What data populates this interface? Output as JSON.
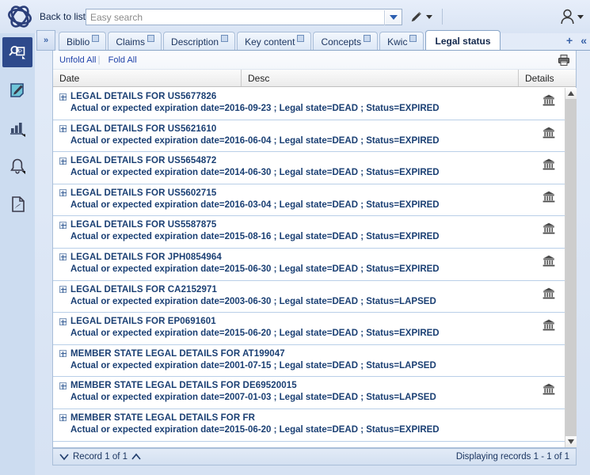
{
  "topbar": {
    "logo_icon": "atom-logo-icon",
    "back_to_list": "Back to list",
    "search_placeholder": "Easy search",
    "search_value": "",
    "dropdown_icon": "chevron-down-icon",
    "pen_icon": "pen-icon",
    "pen_caret_icon": "caret-down-icon",
    "user_icon": "user-icon",
    "user_caret_icon": "caret-down-icon"
  },
  "rail": {
    "items": [
      {
        "icon": "search-patent-icon",
        "active": true
      },
      {
        "icon": "edit-note-icon",
        "active": false
      },
      {
        "icon": "bar-chart-icon",
        "active": false
      },
      {
        "icon": "bell-alert-icon",
        "active": false
      },
      {
        "icon": "pdf-file-icon",
        "active": false
      }
    ]
  },
  "tabbar": {
    "expand_icon": "double-chevron-right-icon",
    "tabs": [
      {
        "label": "Biblio",
        "active": false,
        "popout_icon": "popout-icon"
      },
      {
        "label": "Claims",
        "active": false,
        "popout_icon": "popout-icon"
      },
      {
        "label": "Description",
        "active": false,
        "popout_icon": "popout-icon"
      },
      {
        "label": "Key content",
        "active": false,
        "popout_icon": "popout-icon"
      },
      {
        "label": "Concepts",
        "active": false,
        "popout_icon": "popout-icon"
      },
      {
        "label": "Kwic",
        "active": false,
        "popout_icon": "popout-icon"
      },
      {
        "label": "Legal status",
        "active": true,
        "popout_icon": null
      }
    ],
    "add_label": "+",
    "collapse_label": "«"
  },
  "toolbar": {
    "unfold_all": "Unfold All",
    "fold_all": "Fold All",
    "separator": "|",
    "print_icon": "printer-icon"
  },
  "table": {
    "columns": [
      "Date",
      "Desc",
      "Details"
    ],
    "rows": [
      {
        "title": "LEGAL DETAILS FOR US5677826",
        "desc": "Actual or expected expiration date=2016-09-23 ; Legal state=DEAD ; Status=EXPIRED",
        "details_icon": "bank-icon"
      },
      {
        "title": "LEGAL DETAILS FOR US5621610",
        "desc": "Actual or expected expiration date=2016-06-04 ; Legal state=DEAD ; Status=EXPIRED",
        "details_icon": "bank-icon"
      },
      {
        "title": "LEGAL DETAILS FOR US5654872",
        "desc": "Actual or expected expiration date=2014-06-30 ; Legal state=DEAD ; Status=EXPIRED",
        "details_icon": "bank-icon"
      },
      {
        "title": "LEGAL DETAILS FOR US5602715",
        "desc": "Actual or expected expiration date=2016-03-04 ; Legal state=DEAD ; Status=EXPIRED",
        "details_icon": "bank-icon"
      },
      {
        "title": "LEGAL DETAILS FOR US5587875",
        "desc": "Actual or expected expiration date=2015-08-16 ; Legal state=DEAD ; Status=EXPIRED",
        "details_icon": "bank-icon"
      },
      {
        "title": "LEGAL DETAILS FOR JPH0854964",
        "desc": "Actual or expected expiration date=2015-06-30 ; Legal state=DEAD ; Status=EXPIRED",
        "details_icon": "bank-icon"
      },
      {
        "title": "LEGAL DETAILS FOR CA2152971",
        "desc": "Actual or expected expiration date=2003-06-30 ; Legal state=DEAD ; Status=LAPSED",
        "details_icon": "bank-icon"
      },
      {
        "title": "LEGAL DETAILS FOR EP0691601",
        "desc": "Actual or expected expiration date=2015-06-20 ; Legal state=DEAD ; Status=EXPIRED",
        "details_icon": "bank-icon"
      },
      {
        "title": "MEMBER STATE LEGAL DETAILS FOR AT199047",
        "desc": "Actual or expected expiration date=2001-07-15 ; Legal state=DEAD ; Status=LAPSED",
        "details_icon": null
      },
      {
        "title": "MEMBER STATE LEGAL DETAILS FOR DE69520015",
        "desc": "Actual or expected expiration date=2007-01-03 ; Legal state=DEAD ; Status=LAPSED",
        "details_icon": "bank-icon"
      },
      {
        "title": "MEMBER STATE LEGAL DETAILS FOR FR",
        "desc": "Actual or expected expiration date=2015-06-20 ; Legal state=DEAD ; Status=EXPIRED",
        "details_icon": null
      }
    ]
  },
  "footer": {
    "prev_icon": "chevron-down-icon",
    "record_label": "Record 1 of 1",
    "next_icon": "chevron-up-icon",
    "displaying": "Displaying records 1 - 1 of 1"
  },
  "colors": {
    "accent": "#2e4a8c",
    "link": "#2244aa",
    "row_text": "#1a3f73",
    "rail_bg": "#ccdcf0"
  }
}
